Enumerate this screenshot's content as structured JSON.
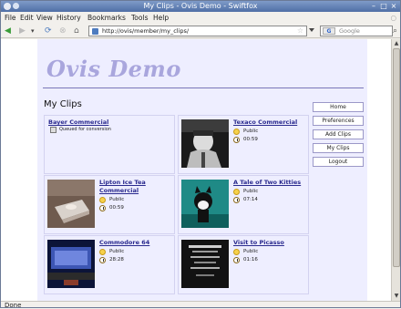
{
  "window": {
    "title": "My Clips - Ovis Demo - Swiftfox"
  },
  "menu": {
    "file": "File",
    "edit": "Edit",
    "view": "View",
    "history": "History",
    "bookmarks": "Bookmarks",
    "tools": "Tools",
    "help": "Help"
  },
  "nav": {
    "url": "http://ovis/member/my_clips/",
    "search_placeholder": "Google",
    "search_engine": "G"
  },
  "status": "Done",
  "site": {
    "logo": "Ovis Demo",
    "page_title": "My Clips",
    "sidebar": [
      "Home",
      "Preferences",
      "Add Clips",
      "My Clips",
      "Logout"
    ]
  },
  "clips": [
    {
      "title": "Bayer Commercial",
      "queued_text": "Queued for conversion"
    },
    {
      "title": "Texaco Commercial",
      "visibility": "Public",
      "duration": "00:59"
    },
    {
      "title": "Lipton Ice Tea Commercial",
      "visibility": "Public",
      "duration": "00:59"
    },
    {
      "title": "A Tale of Two Kitties",
      "visibility": "Public",
      "duration": "07:14"
    },
    {
      "title": "Commodore 64",
      "visibility": "Public",
      "duration": "28:28"
    },
    {
      "title": "Visit to Picasso",
      "visibility": "Public",
      "duration": "01:16"
    }
  ]
}
